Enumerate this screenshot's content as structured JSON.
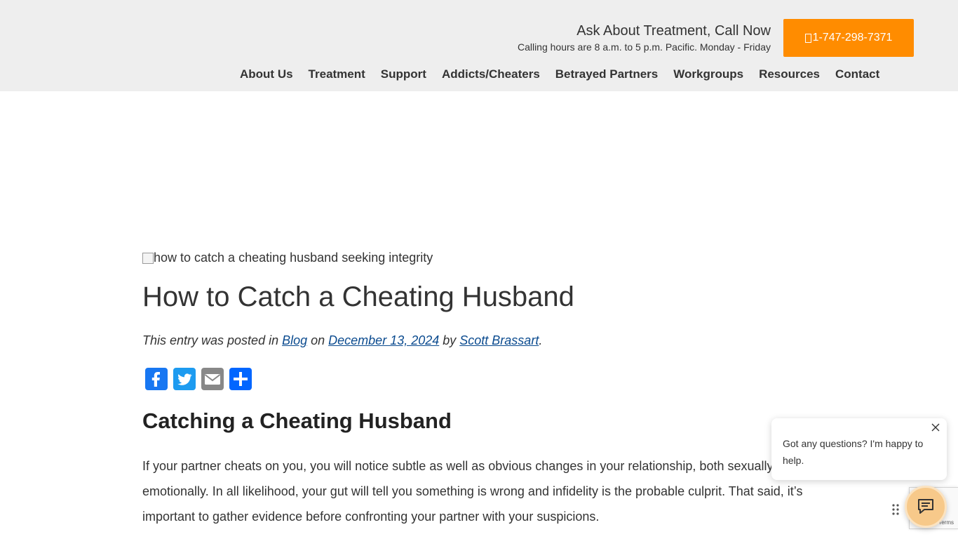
{
  "header": {
    "cta_title": "Ask About Treatment, Call Now",
    "cta_subtitle": "Calling hours are 8 a.m. to 5 p.m. Pacific. Monday - Friday",
    "phone_button": "1-747-298-7371",
    "phone_icon": "phone-icon",
    "nav": [
      "About Us",
      "Treatment",
      "Support",
      "Addicts/Cheaters",
      "Betrayed Partners",
      "Workgroups",
      "Resources",
      "Contact"
    ]
  },
  "article": {
    "image_alt": "how to catch a cheating husband seeking integrity",
    "title": "How to Catch a Cheating Husband",
    "meta": {
      "prefix": "This entry was posted in ",
      "category": "Blog",
      "on": " on ",
      "date": "December 13, 2024",
      "by": " by ",
      "author": "Scott Brassart",
      "suffix": "."
    },
    "share": [
      {
        "name": "Facebook",
        "icon": "facebook-icon",
        "color": "#1877f2"
      },
      {
        "name": "Twitter",
        "icon": "twitter-icon",
        "color": "#1d9bf0"
      },
      {
        "name": "Email",
        "icon": "email-icon",
        "color": "#888888"
      },
      {
        "name": "Share",
        "icon": "share-icon",
        "color": "#0166ff"
      }
    ],
    "heading": "Catching a Cheating Husband",
    "paragraph": "If your partner cheats on you, you will notice subtle as well as obvious changes in your relationship, both sexually and emotionally. In all likelihood, your gut will tell you something is wrong and infidelity is the probable culprit. That said, it’s important to gather evidence before confronting your partner with your suspicions."
  },
  "chat": {
    "message": "Got any questions? I'm happy to help.",
    "close_icon": "close-icon",
    "launcher_icon": "chat-icon",
    "accent": "#f7c98a"
  },
  "recaptcha": {
    "terms": "Terms"
  },
  "colors": {
    "header_bg": "#eeeeee",
    "cta_orange": "#ff8c00",
    "link": "#0b4b8f"
  }
}
